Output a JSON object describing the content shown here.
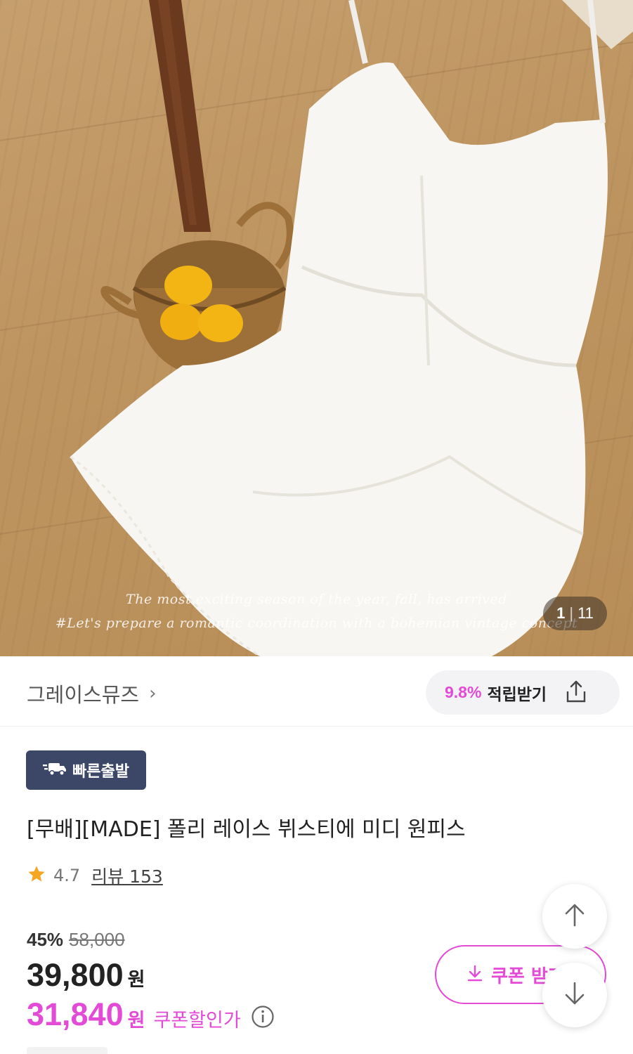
{
  "product_image": {
    "caption_line1": "The most exciting season of the year, fall, has arrived",
    "caption_line2": "#Let's prepare a romantic coordination with a bohemian vintage concept",
    "counter": {
      "current": "1",
      "separator": "|",
      "total": "11"
    }
  },
  "brand": {
    "name": "그레이스뮤즈",
    "chevron": "›",
    "reward_percent": "9.8%",
    "reward_label": "적립받기"
  },
  "badge": {
    "label": "빠른출발",
    "icon": "truck-icon"
  },
  "product": {
    "title": "[무배][MADE] 폴리 레이스 뷔스티에 미디 원피스",
    "rating": "4.7",
    "review_label": "리뷰 153"
  },
  "price": {
    "discount_percent": "45%",
    "original": "58,000",
    "sale": "39,800",
    "currency": "원",
    "coupon_price": "31,840",
    "coupon_label": "쿠폰할인가"
  },
  "coupon_button": {
    "label": "쿠폰 받기"
  },
  "colors": {
    "accent": "#e34ad6",
    "badge_bg": "#3c4666",
    "star": "#f5a623"
  }
}
